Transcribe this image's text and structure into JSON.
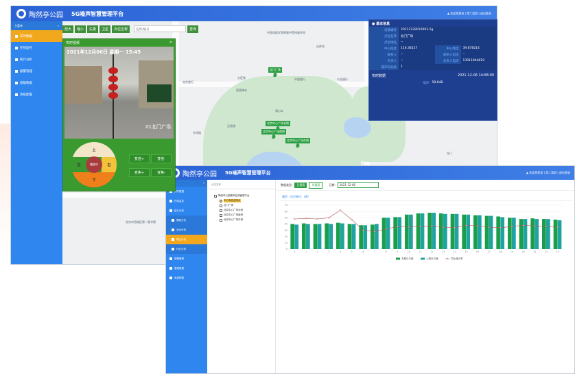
{
  "back": {
    "logo_text": "陶然亭公园",
    "title": "5G噪声智慧管理平台",
    "user_bar": "▲ 欢迎您登录 | 第二离群 | 退出登录",
    "menu_head": "主菜单",
    "menu": [
      "实时数据",
      "在线监控",
      "统计分析",
      "报警管理",
      "基础数据",
      "系统配置"
    ],
    "toolbar": [
      "放大",
      "缩小",
      "矢量",
      "卫星",
      "点位名称"
    ],
    "search_placeholder": "名称/编号",
    "search_btn": "查询",
    "map_labels": [
      "中国戏剧学院附属中等戏曲学校",
      "吉祥坊",
      "北京银行",
      "大莊院",
      "观音禅寺",
      "中国银行",
      "兴业银行",
      "湖心岛",
      "南门",
      "北京市西城区第一图书馆",
      "云绘楼",
      "京华楼",
      "陶然亭公园",
      "大众出版",
      "陶然桥北",
      "东门"
    ],
    "markers": [
      "北门广场",
      "北京中心广场北侧",
      "北京中心广场南侧",
      "北京中心广场东侧"
    ],
    "video": {
      "panel_title": "实时视频",
      "close": "×",
      "timestamp": "2021年12月06日 星期一 15:45",
      "location": "01北门广场"
    },
    "ptz": {
      "up": "上",
      "down": "下",
      "left": "左",
      "right": "右",
      "center": "播放中"
    },
    "zoom_buttons": [
      "变倍+",
      "变倍-",
      "变焦+",
      "变焦-"
    ],
    "info": {
      "basic_title": "基本信息",
      "rows": [
        {
          "k": "设备编号",
          "v": "20211128010003-5g"
        },
        {
          "k": "点位名称",
          "v": "北门广场"
        },
        {
          "k": "点位地址",
          "v": "--"
        }
      ],
      "coords": {
        "lng_k": "中心经度",
        "lng_v": "116.38227",
        "lat_k": "中心纬度",
        "lat_v": "39.878214"
      },
      "pair_rows": [
        {
          "k1": "联系人",
          "v1": "--",
          "k2": "联系人电话",
          "v2": "--"
        },
        {
          "k1": "负责人",
          "v1": "--",
          "k2": "负责人电话",
          "v2": "13911944819"
        },
        {
          "k1": "噪声标准类",
          "v1": "1",
          "k2": "",
          "v2": ""
        }
      ],
      "realtime_title": "实时数据",
      "realtime_time": "2021-12-06 14:68:00",
      "noise_label": "噪声",
      "noise_value": "58.6dB"
    }
  },
  "front": {
    "logo_text": "陶然亭公园",
    "title": "5G噪声智慧管理平台",
    "user_bar": "▲ 欢迎您登录 | 第二离群 | 退出登录",
    "menu_head": "主菜单",
    "menu": [
      "实时数据",
      "在线监控",
      "统计分析"
    ],
    "submenu": [
      "基础分析",
      "对比分析",
      "同比分析",
      "环比分析"
    ],
    "menu_rest": [
      "报警管理",
      "基础数据",
      "系统配置"
    ],
    "tree_head": "点位名称",
    "tree": {
      "root": "陶然亭公园噪声监测管理平台",
      "items": [
        "中心电信监测点",
        "北门广场",
        "北京中心广场北侧",
        "北京中心广场南侧",
        "北京中心广场东侧"
      ]
    },
    "filter": {
      "type_label": "数据类型:",
      "btn_day": "日报表",
      "btn_month": "月报表",
      "date_label": "日期:",
      "date_value": "2021-12-08"
    },
    "chart_header": "噪声（分贝单位：dB）"
  },
  "chart_data": {
    "type": "bar",
    "title": "噪声（分贝单位：dB）",
    "categories": [
      "0",
      "1",
      "2",
      "3",
      "4",
      "5",
      "6",
      "7",
      "8",
      "9",
      "10",
      "11",
      "12",
      "13",
      "14",
      "15",
      "16",
      "17",
      "18",
      "19",
      "20",
      "21",
      "22",
      "23"
    ],
    "series": [
      {
        "name": "本期分贝值",
        "values": [
          40,
          41,
          40,
          41,
          42,
          40,
          38,
          39,
          50,
          51,
          55,
          57,
          58,
          57,
          56,
          55,
          54,
          53,
          52,
          50,
          48,
          49,
          48,
          47
        ]
      },
      {
        "name": "上期分贝值",
        "values": [
          39,
          40,
          40,
          40,
          41,
          40,
          38,
          40,
          50,
          51,
          55,
          57,
          58,
          56,
          56,
          55,
          54,
          53,
          51,
          50,
          48,
          48,
          48,
          46
        ]
      },
      {
        "name": "同比增长率",
        "values": [
          48,
          49,
          48,
          50,
          62,
          47,
          30,
          28,
          32,
          36,
          35,
          36,
          37,
          35,
          34,
          38,
          37,
          35,
          34,
          36,
          38,
          37,
          36,
          35
        ]
      }
    ],
    "ylim": [
      0,
      70
    ],
    "yticks": [
      "0",
      "10",
      "20",
      "30",
      "40",
      "50",
      "60",
      "70"
    ],
    "colors": {
      "current": "#1a9e4a",
      "previous": "#1fa3a0",
      "growth": "#b05050"
    },
    "legend": "bottom"
  }
}
